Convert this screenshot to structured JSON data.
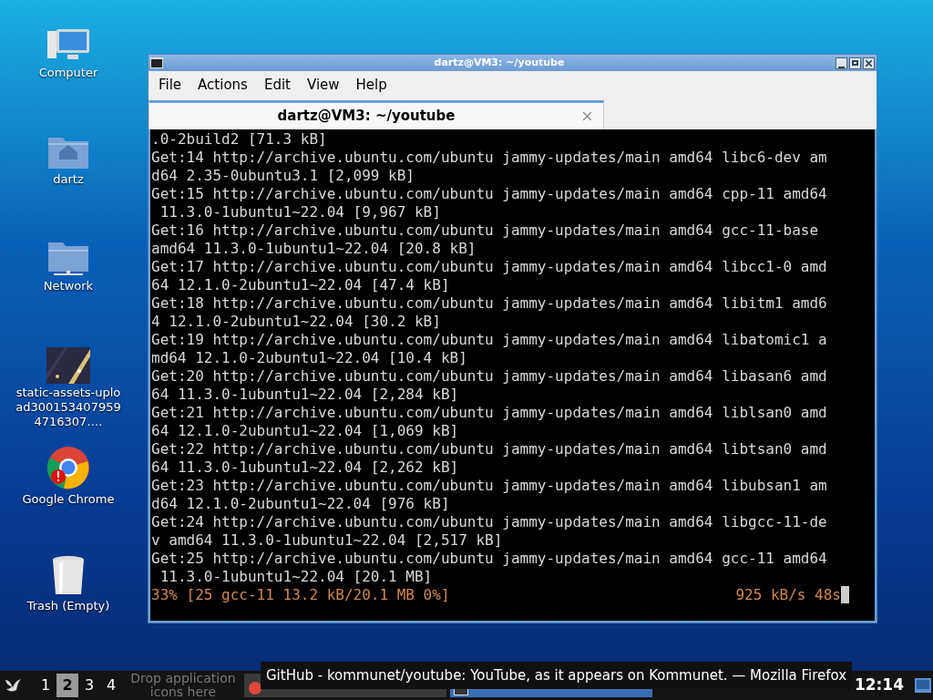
{
  "desktop_icons": [
    {
      "kind": "computer",
      "label": "Computer"
    },
    {
      "kind": "home",
      "label": "dartz"
    },
    {
      "kind": "network",
      "label": "Network"
    },
    {
      "kind": "image",
      "label": "static-assets-upload3001534079594716307.…"
    },
    {
      "kind": "chrome",
      "label": "Google Chrome"
    },
    {
      "kind": "trash",
      "label": "Trash (Empty)"
    }
  ],
  "window": {
    "title": "dartz@VM3: ~/youtube",
    "menu": [
      "File",
      "Actions",
      "Edit",
      "View",
      "Help"
    ],
    "tabs": [
      {
        "label": "dartz@VM3: ~/youtube",
        "selected": true
      }
    ],
    "terminal_lines": [
      ".0-2build2 [71.3 kB]",
      "Get:14 http://archive.ubuntu.com/ubuntu jammy-updates/main amd64 libc6-dev am",
      "d64 2.35-0ubuntu3.1 [2,099 kB]",
      "Get:15 http://archive.ubuntu.com/ubuntu jammy-updates/main amd64 cpp-11 amd64",
      " 11.3.0-1ubuntu1~22.04 [9,967 kB]",
      "Get:16 http://archive.ubuntu.com/ubuntu jammy-updates/main amd64 gcc-11-base",
      "amd64 11.3.0-1ubuntu1~22.04 [20.8 kB]",
      "Get:17 http://archive.ubuntu.com/ubuntu jammy-updates/main amd64 libcc1-0 amd",
      "64 12.1.0-2ubuntu1~22.04 [47.4 kB]",
      "Get:18 http://archive.ubuntu.com/ubuntu jammy-updates/main amd64 libitm1 amd6",
      "4 12.1.0-2ubuntu1~22.04 [30.2 kB]",
      "Get:19 http://archive.ubuntu.com/ubuntu jammy-updates/main amd64 libatomic1 a",
      "md64 12.1.0-2ubuntu1~22.04 [10.4 kB]",
      "Get:20 http://archive.ubuntu.com/ubuntu jammy-updates/main amd64 libasan6 amd",
      "64 11.3.0-1ubuntu1~22.04 [2,284 kB]",
      "Get:21 http://archive.ubuntu.com/ubuntu jammy-updates/main amd64 liblsan0 amd",
      "64 12.1.0-2ubuntu1~22.04 [1,069 kB]",
      "Get:22 http://archive.ubuntu.com/ubuntu jammy-updates/main amd64 libtsan0 amd",
      "64 11.3.0-1ubuntu1~22.04 [2,262 kB]",
      "Get:23 http://archive.ubuntu.com/ubuntu jammy-updates/main amd64 libubsan1 am",
      "d64 12.1.0-2ubuntu1~22.04 [976 kB]",
      "Get:24 http://archive.ubuntu.com/ubuntu jammy-updates/main amd64 libgcc-11-de",
      "v amd64 11.3.0-1ubuntu1~22.04 [2,517 kB]",
      "Get:25 http://archive.ubuntu.com/ubuntu jammy-updates/main amd64 gcc-11 amd64",
      " 11.3.0-1ubuntu1~22.04 [20.1 MB]"
    ],
    "progress": {
      "left": "33% [25 gcc-11 13.2 kB/20.1 MB 0%]",
      "right": "925 kB/s 48s"
    }
  },
  "taskbar": {
    "workspaces": [
      {
        "label": "1",
        "selected": false
      },
      {
        "label": "2",
        "selected": true
      },
      {
        "label": "3",
        "selected": false
      },
      {
        "label": "4",
        "selected": false
      }
    ],
    "drop_hint": "Drop application icons here",
    "tasks": [
      {
        "kind": "browser",
        "selected": false
      },
      {
        "kind": "terminal",
        "selected": true
      }
    ],
    "tooltip": "GitHub - kommunet/youtube: YouTube, as it appears on Kommunet. — Mozilla Firefox",
    "clock": "12:14"
  }
}
